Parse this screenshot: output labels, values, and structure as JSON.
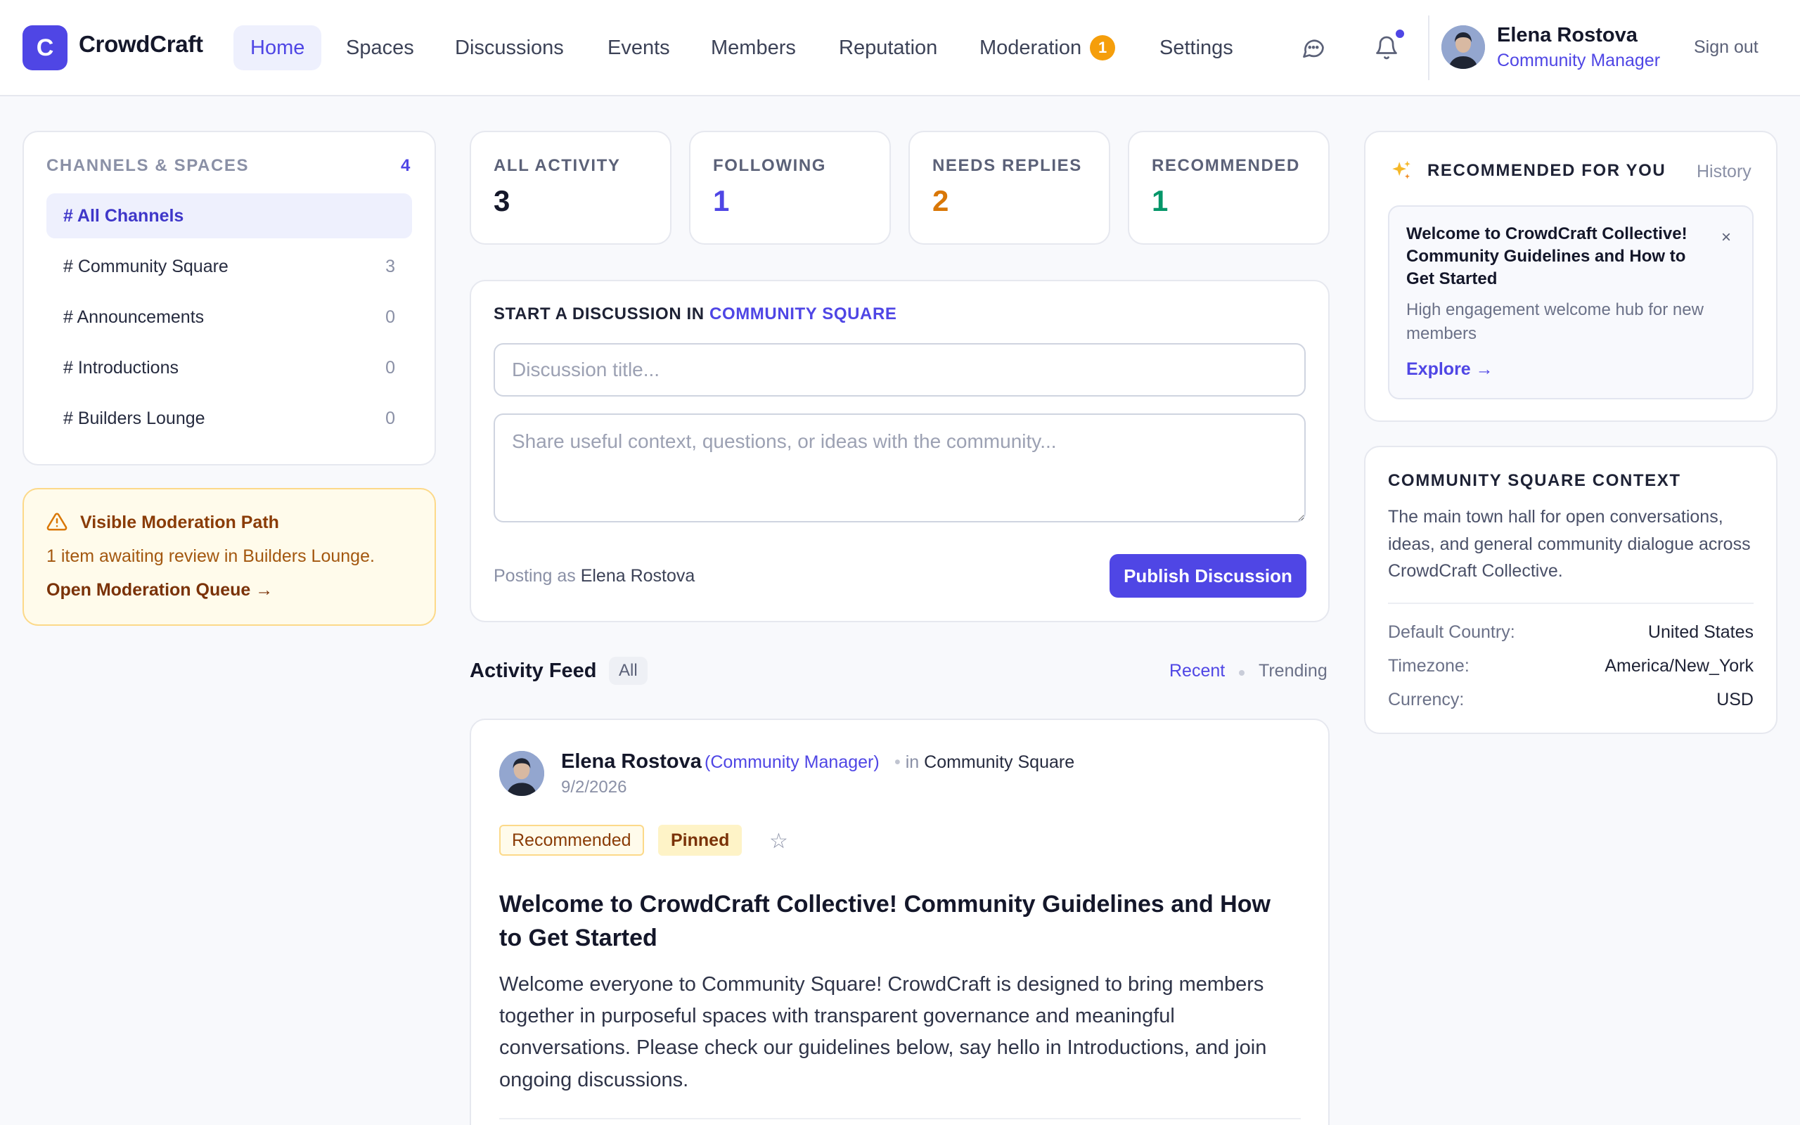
{
  "brand": {
    "initial": "C",
    "name": "CrowdCraft",
    "accent": "#4f46e5"
  },
  "nav": {
    "items": [
      {
        "label": "Home",
        "active": true
      },
      {
        "label": "Spaces"
      },
      {
        "label": "Discussions"
      },
      {
        "label": "Events"
      },
      {
        "label": "Members"
      },
      {
        "label": "Reputation"
      },
      {
        "label": "Moderation",
        "badge": "1"
      },
      {
        "label": "Settings"
      }
    ]
  },
  "header": {
    "icons": [
      "chat-icon",
      "bell-icon"
    ],
    "user": {
      "name": "Elena Rostova",
      "role": "Community Manager"
    },
    "signout_label": "Sign out"
  },
  "sidebar": {
    "title": "CHANNELS & SPACES",
    "count": "4",
    "channels": [
      {
        "label": "# All Channels",
        "count": "",
        "active": true
      },
      {
        "label": "# Community Square",
        "count": "3"
      },
      {
        "label": "# Announcements",
        "count": "0"
      },
      {
        "label": "# Introductions",
        "count": "0"
      },
      {
        "label": "# Builders Lounge",
        "count": "0"
      }
    ]
  },
  "moderation": {
    "icon": "warning-icon",
    "title": "Visible Moderation Path",
    "text": "1 item awaiting review in Builders Lounge.",
    "link": "Open Moderation Queue →"
  },
  "stats": [
    {
      "label": "ALL ACTIVITY",
      "value": "3",
      "color": "#14172a"
    },
    {
      "label": "FOLLOWING",
      "value": "1",
      "color": "#4f46e5"
    },
    {
      "label": "NEEDS REPLIES",
      "value": "2",
      "color": "#d97706"
    },
    {
      "label": "RECOMMENDED",
      "value": "1",
      "color": "#059669"
    }
  ],
  "composer": {
    "heading_prefix": "START A DISCUSSION IN",
    "heading_space": "COMMUNITY SQUARE",
    "title_placeholder": "Discussion title...",
    "body_placeholder": "Share useful context, questions, or ideas with the community...",
    "posting_as_label": "Posting as",
    "posting_as_name": "Elena Rostova",
    "publish_label": "Publish Discussion"
  },
  "feed": {
    "title": "Activity Feed",
    "filter": "All",
    "sort_recent": "Recent",
    "sort_trending": "Trending"
  },
  "post": {
    "author": "Elena Rostova",
    "role": "(Community Manager)",
    "in_label": "in",
    "space": "Community Square",
    "date": "9/2/2026",
    "tags": [
      "Recommended",
      "Pinned"
    ],
    "star": "☆",
    "title": "Welcome to CrowdCraft Collective! Community Guidelines and How to Get Started",
    "body": "Welcome everyone to Community Square! CrowdCraft is designed to bring members together in purposeful spaces with transparent governance and meaningful conversations. Please check our guidelines below, say hello in Introductions, and join ongoing discussions."
  },
  "recommended": {
    "icon": "sparkles-icon",
    "title": "RECOMMENDED FOR YOU",
    "history_label": "History",
    "item": {
      "title": "Welcome to CrowdCraft Collective! Community Guidelines and How to Get Started",
      "close": "×",
      "description": "High engagement welcome hub for new members",
      "link": "Explore →"
    }
  },
  "context": {
    "title": "COMMUNITY SQUARE CONTEXT",
    "description": "The main town hall for open conversations, ideas, and general community dialogue across CrowdCraft Collective.",
    "rows": [
      {
        "key": "Default Country:",
        "value": "United States"
      },
      {
        "key": "Timezone:",
        "value": "America/New_York"
      },
      {
        "key": "Currency:",
        "value": "USD"
      }
    ]
  }
}
